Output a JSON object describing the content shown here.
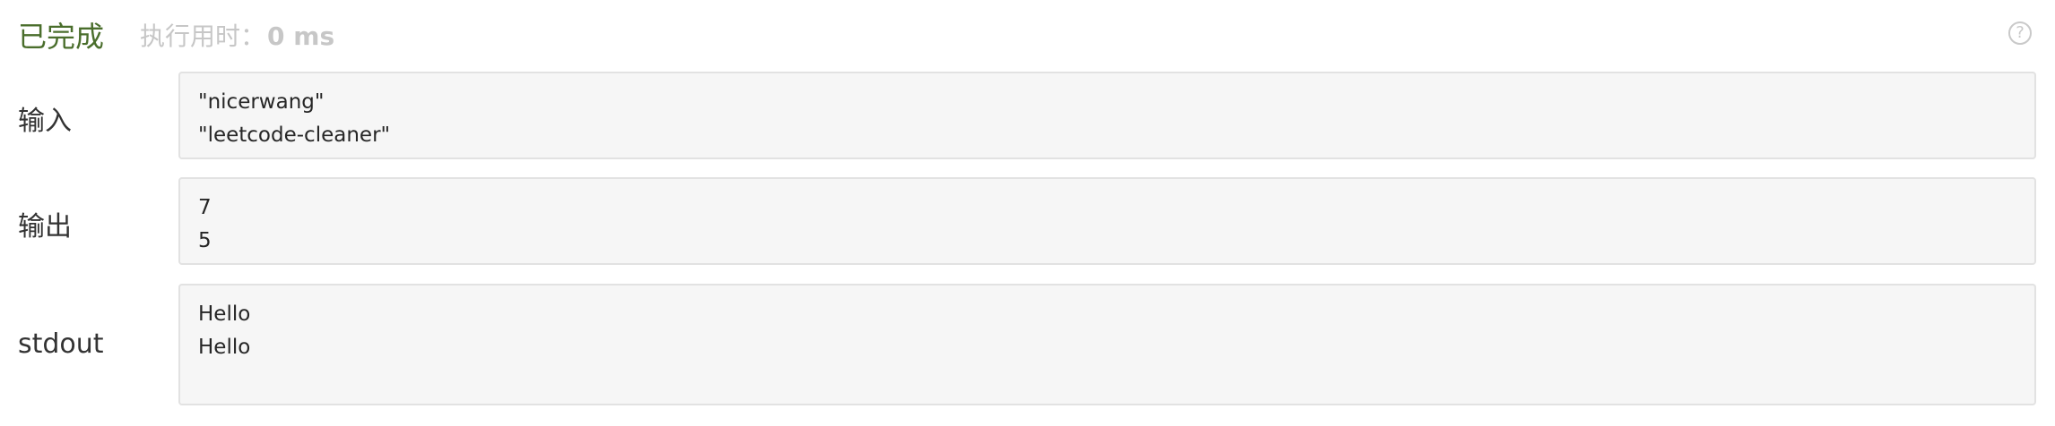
{
  "status": {
    "label": "已完成",
    "timing_label": "执行用时：",
    "timing_value": "0 ms",
    "help_icon": "question-circle-icon"
  },
  "rows": [
    {
      "label": "输入",
      "lines": [
        "\"nicerwang\"",
        "\"leetcode-cleaner\""
      ]
    },
    {
      "label": "输出",
      "lines": [
        "7",
        "5"
      ]
    },
    {
      "label": "stdout",
      "lines": [
        "Hello",
        "Hello"
      ]
    }
  ],
  "colors": {
    "status": "#4a6e2c",
    "muted": "#c7c7c7",
    "box_bg": "#f6f6f6",
    "box_border": "#e2e2e2"
  }
}
